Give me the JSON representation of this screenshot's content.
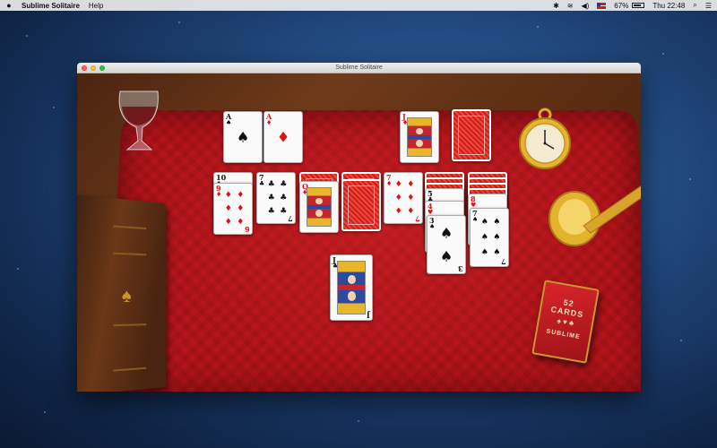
{
  "menubar": {
    "app_name": "Sublime Solitaire",
    "menus": [
      "Help"
    ],
    "battery_percent": "67%",
    "clock": "Thu 22:48"
  },
  "window": {
    "title": "Sublime Solitaire"
  },
  "colors": {
    "felt": "#b5141a",
    "card_red": "#d11111",
    "card_black": "#111111",
    "brass": "#c9962e"
  },
  "table": {
    "foundations": [
      {
        "rank": "A",
        "suit": "♠",
        "color": "black"
      },
      {
        "rank": "A",
        "suit": "♦",
        "color": "red"
      }
    ],
    "waste": {
      "rank": "J",
      "suit": "♦",
      "color": "red",
      "face": true
    },
    "stock": {
      "face_down": true
    },
    "tableau_top": [
      {
        "rank": "10",
        "suit": "♠",
        "color": "black"
      },
      {
        "rank": "7",
        "suit": "♣",
        "color": "black"
      },
      {
        "rank": "",
        "suit": "",
        "color": "",
        "face_down": true
      },
      {
        "rank": "",
        "suit": "",
        "color": "",
        "face_down": true
      },
      {
        "rank": "7",
        "suit": "♦",
        "color": "red"
      },
      {
        "rank": "",
        "suit": "",
        "color": "",
        "face_down": true
      },
      {
        "rank": "",
        "suit": "",
        "color": "",
        "face_down": true
      }
    ],
    "tableau_cards": [
      {
        "rank": "9",
        "suit": "♦",
        "color": "red",
        "br": "6"
      },
      {
        "rank": "7",
        "suit": "♣",
        "color": "black",
        "br": "7"
      },
      {
        "rank": "Q",
        "suit": "♦",
        "color": "red",
        "face": true
      },
      {
        "rank": "",
        "suit": "",
        "color": "",
        "face_down": true
      },
      {
        "rank": "7",
        "suit": "♦",
        "color": "red",
        "br": "7"
      },
      {
        "rank": "3",
        "suit": "♠",
        "color": "black",
        "br": "3"
      },
      {
        "rank": "7",
        "suit": "♠",
        "color": "black",
        "br": "7"
      }
    ],
    "stacked_cards": [
      {
        "rank": "5",
        "suit": "♣",
        "color": "black"
      },
      {
        "rank": "4",
        "suit": "♥",
        "color": "red"
      },
      {
        "rank": "8",
        "suit": "♥",
        "color": "red"
      }
    ],
    "dragged_card": {
      "rank": "J",
      "suit": "♣",
      "color": "black",
      "face": true,
      "br": "J"
    }
  },
  "deckbox": {
    "line1": "52",
    "line2": "CARDS",
    "brand": "SUBLIME"
  }
}
